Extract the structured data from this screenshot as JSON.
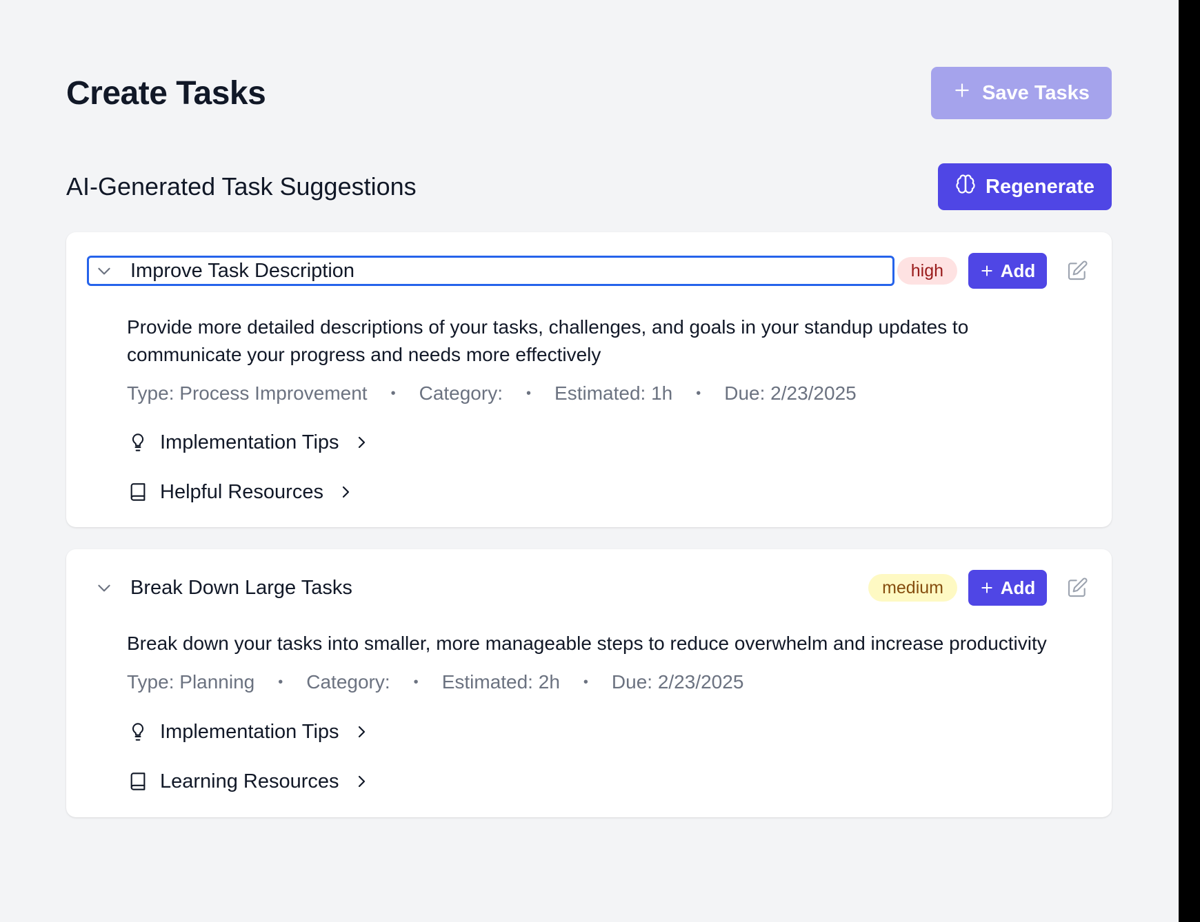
{
  "header": {
    "title": "Create Tasks",
    "save_label": "Save Tasks"
  },
  "section": {
    "title": "AI-Generated Task Suggestions",
    "regenerate_label": "Regenerate"
  },
  "colors": {
    "accent": "#4f46e5",
    "accent_disabled": "#a5a3ec",
    "focus_ring": "#2563eb",
    "high": "#991b1b",
    "medium": "#854d0e"
  },
  "tasks": [
    {
      "title": "Improve Task Description",
      "priority": "high",
      "add_label": "Add",
      "description": "Provide more detailed descriptions of your tasks, challenges, and goals in your standup updates to communicate your progress and needs more effectively",
      "type": "Type: Process Improvement",
      "category": "Category:",
      "estimated": "Estimated: 1h",
      "due": "Due: 2/23/2025",
      "tips_label": "Implementation Tips",
      "resources_label": "Helpful Resources"
    },
    {
      "title": "Break Down Large Tasks",
      "priority": "medium",
      "add_label": "Add",
      "description": "Break down your tasks into smaller, more manageable steps to reduce overwhelm and increase productivity",
      "type": "Type: Planning",
      "category": "Category:",
      "estimated": "Estimated: 2h",
      "due": "Due: 2/23/2025",
      "tips_label": "Implementation Tips",
      "resources_label": "Learning Resources"
    }
  ]
}
